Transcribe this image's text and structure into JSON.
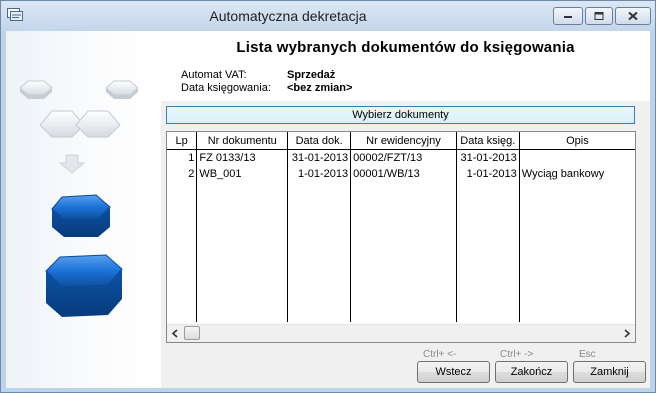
{
  "window": {
    "title": "Automatyczna dekretacja",
    "icon": "app-icon",
    "controls": [
      "minimize-icon",
      "maximize-icon",
      "close-icon"
    ]
  },
  "header": {
    "title": "Lista wybranych dokumentów do księgowania",
    "vat_label": "Automat VAT:",
    "vat_value": "Sprzedaż",
    "date_label": "Data księgowania:",
    "date_value": "<bez zmian>"
  },
  "select_button": "Wybierz dokumenty",
  "table": {
    "columns": [
      "Lp",
      "Nr dokumentu",
      "Data dok.",
      "Nr ewidencyjny",
      "Data księg.",
      "Opis"
    ],
    "rows": [
      [
        "1",
        "FZ 0133/13",
        "31-01-2013",
        "00002/FZT/13",
        "31-01-2013",
        ""
      ],
      [
        "2",
        "WB_001",
        "1-01-2013",
        "00001/WB/13",
        "1-01-2013",
        "Wyciąg bankowy"
      ]
    ],
    "scrollbar": {
      "left_arrow": "<",
      "right_arrow": ">"
    }
  },
  "footer": {
    "shortcuts": [
      "Ctrl+ <-",
      "Ctrl+ ->",
      "Esc"
    ],
    "buttons": [
      "Wstecz",
      "Zakończ",
      "Zamknij"
    ]
  },
  "colors": {
    "accent_blue": "#1a72d8",
    "titlebar": "#c9dbee",
    "highlight_border": "#3c7fb1"
  }
}
